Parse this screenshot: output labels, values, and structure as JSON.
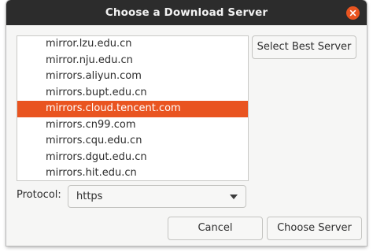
{
  "dialog": {
    "title": "Choose a Download Server",
    "close_icon": "close-icon",
    "accent_color": "#e95420"
  },
  "server_list": {
    "items": [
      "mirror.lzu.edu.cn",
      "mirror.nju.edu.cn",
      "mirrors.aliyun.com",
      "mirrors.bupt.edu.cn",
      "mirrors.cloud.tencent.com",
      "mirrors.cn99.com",
      "mirrors.cqu.edu.cn",
      "mirrors.dgut.edu.cn",
      "mirrors.hit.edu.cn"
    ],
    "selected": "mirrors.cloud.tencent.com"
  },
  "buttons": {
    "select_best": "Select Best Server",
    "cancel": "Cancel",
    "choose": "Choose Server"
  },
  "protocol": {
    "label": "Protocol:",
    "value": "https",
    "arrow_icon": "dropdown-arrow-icon"
  }
}
